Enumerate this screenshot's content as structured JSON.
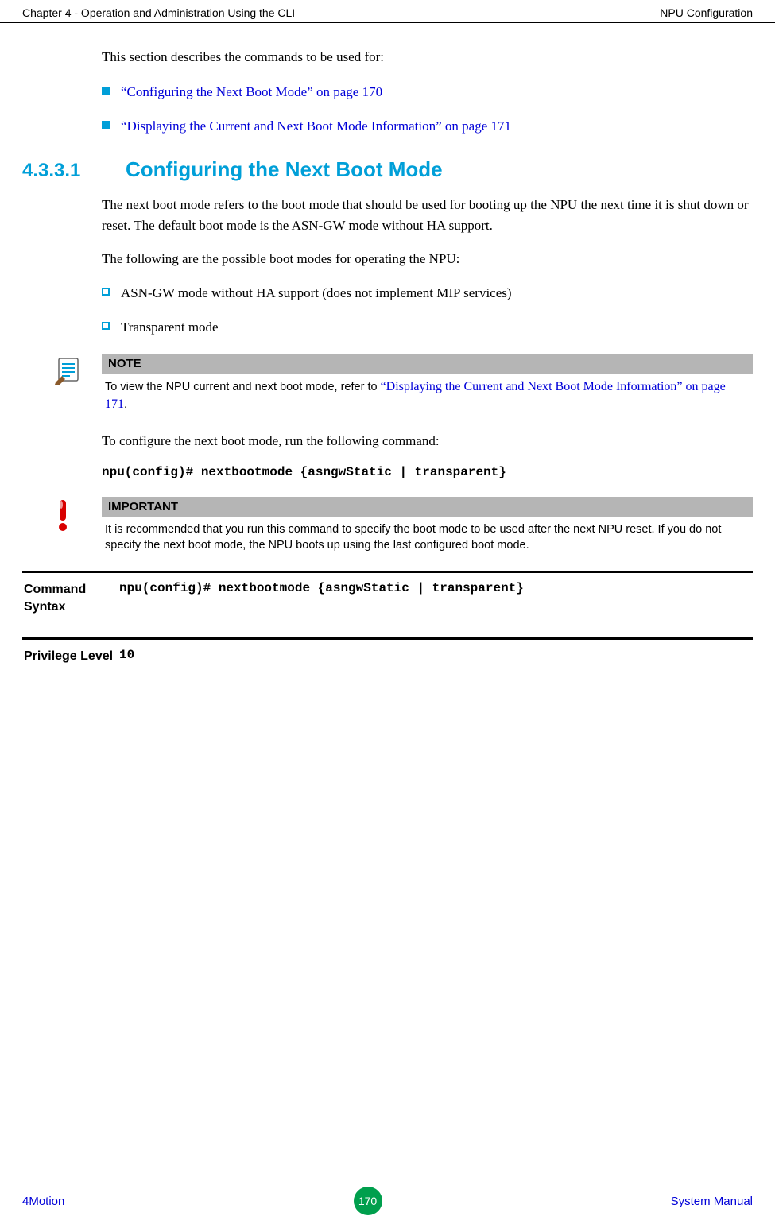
{
  "header": {
    "left": "Chapter 4 - Operation and Administration Using the CLI",
    "right": "NPU Configuration"
  },
  "intro": "This section describes the commands to be used for:",
  "top_links": [
    "“Configuring the Next Boot Mode” on page 170",
    "“Displaying the Current and Next Boot Mode Information” on page 171"
  ],
  "section": {
    "number": "4.3.3.1",
    "title": "Configuring the Next Boot Mode"
  },
  "para1": "The next boot mode refers to the boot mode that should be used for booting up the NPU the next time it is shut down or reset. The default boot mode is the ASN-GW mode without HA support.",
  "para2": "The following are the possible boot modes for operating the NPU:",
  "mode_bullets": [
    "ASN-GW mode without HA support (does not implement MIP services)",
    "Transparent mode"
  ],
  "note": {
    "label": "NOTE",
    "pre": "To view the NPU current and next boot mode, refer to ",
    "link": "“Displaying the Current and Next Boot Mode Information” on page 171",
    "post": "."
  },
  "para3": "To configure the next boot mode, run the following command:",
  "cmd_inline": "npu(config)# nextbootmode {asngwStatic | transparent}",
  "important": {
    "label": "IMPORTANT",
    "text": "It is recommended that you run this command to specify the boot mode to be used after the next NPU reset. If you do not specify the next boot mode, the NPU boots up using the last configured boot mode."
  },
  "command_syntax": {
    "label": "Command Syntax",
    "value": "npu(config)# nextbootmode {asngwStatic | transparent}"
  },
  "privilege": {
    "label": "Privilege Level",
    "value": "10"
  },
  "footer": {
    "left": "4Motion",
    "page": "170",
    "right": "System Manual"
  }
}
